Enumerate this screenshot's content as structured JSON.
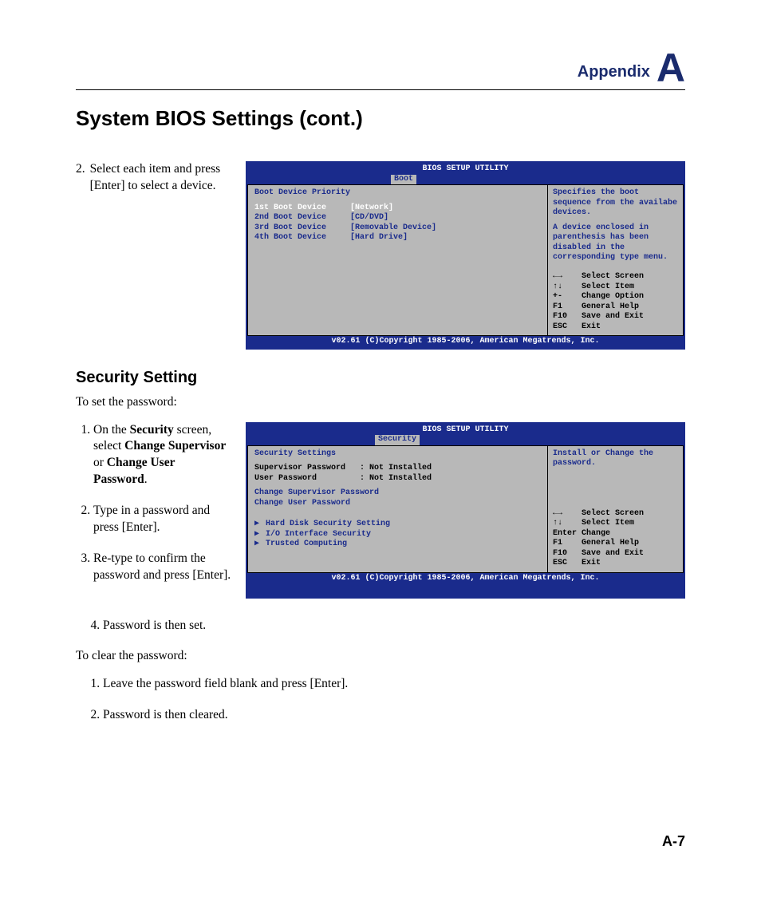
{
  "header": {
    "appendix": "Appendix",
    "letter": "A"
  },
  "title": "System BIOS Settings (cont.)",
  "step2": {
    "num": "2.",
    "text": "Select each item and press [Enter] to select a device."
  },
  "bios1": {
    "titlebar": "BIOS SETUP UTILITY",
    "tab": "Boot",
    "section": "Boot Device Priority",
    "rows": [
      {
        "label": "1st Boot Device",
        "value": "[Network]",
        "hl": true
      },
      {
        "label": "2nd Boot Device",
        "value": "[CD/DVD]",
        "hl": false
      },
      {
        "label": "3rd Boot Device",
        "value": "[Removable Device]",
        "hl": false
      },
      {
        "label": "4th Boot Device",
        "value": "[Hard Drive]",
        "hl": false
      }
    ],
    "help1": "Specifies the boot sequence from the availabe devices.",
    "help2": "A device enclosed in parenthesis has been disabled in the corresponding type menu.",
    "keys": "←→    Select Screen\n↑↓    Select Item\n+-    Change Option\nF1    General Help\nF10   Save and Exit\nESC   Exit",
    "footer": "v02.61 (C)Copyright 1985-2006, American Megatrends, Inc."
  },
  "security_heading": "Security Setting",
  "set_pwd_intro": "To set the password:",
  "set_pwd_steps": [
    {
      "pre": "On the ",
      "b1": "Security",
      "mid1": " screen, select ",
      "b2": "Change Supervisor",
      "mid2": " or ",
      "b3": "Change User Password",
      "post": "."
    },
    {
      "text": "Type in a password and press [Enter]."
    },
    {
      "text": "Re-type to confirm the password and press [Enter]."
    },
    {
      "text": "Password is then set."
    }
  ],
  "bios2": {
    "titlebar": "BIOS SETUP UTILITY",
    "tab": "Security",
    "section": "Security Settings",
    "status": [
      {
        "label": "Supervisor Password",
        "value": ": Not Installed"
      },
      {
        "label": "User Password",
        "value": ": Not Installed"
      }
    ],
    "actions": [
      "Change Supervisor Password",
      "Change User Password"
    ],
    "submenus": [
      "Hard Disk Security Setting",
      "I/O Interface Security",
      "Trusted Computing"
    ],
    "help1": "Install or Change the password.",
    "keys": "←→    Select Screen\n↑↓    Select Item\nEnter Change\nF1    General Help\nF10   Save and Exit\nESC   Exit",
    "footer": "v02.61 (C)Copyright 1985-2006, American Megatrends, Inc."
  },
  "clear_pwd_intro": "To clear the password:",
  "clear_pwd_steps": [
    "Leave the password field blank and press [Enter].",
    "Password is then cleared."
  ],
  "page_num": "A-7"
}
